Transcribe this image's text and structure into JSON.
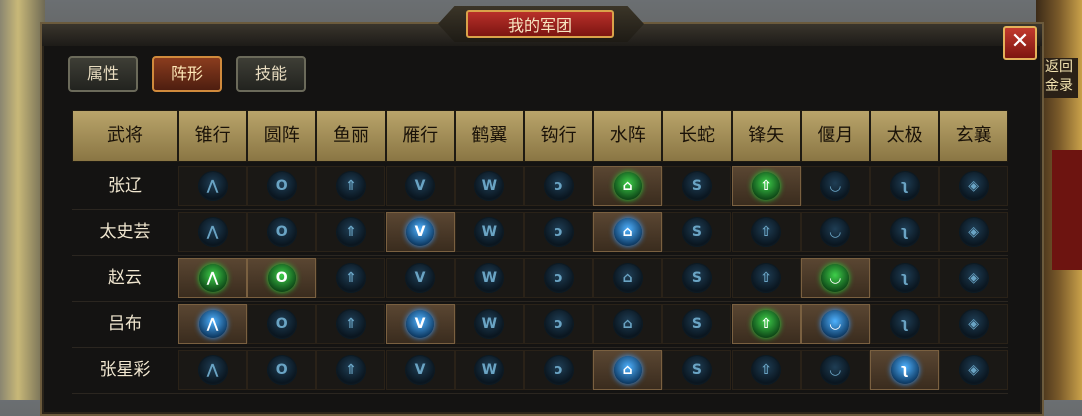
{
  "window": {
    "title": "我的军团",
    "close_symbol": "✕"
  },
  "side": {
    "right_text": "返回\n金录"
  },
  "tabs": [
    {
      "label": "属性",
      "active": false
    },
    {
      "label": "阵形",
      "active": true
    },
    {
      "label": "技能",
      "active": false
    }
  ],
  "table": {
    "name_header": "武将",
    "columns": [
      "锥行",
      "圆阵",
      "鱼丽",
      "雁行",
      "鹤翼",
      "钩行",
      "水阵",
      "长蛇",
      "锋矢",
      "偃月",
      "太极",
      "玄襄"
    ],
    "icon_glyphs": [
      "⋀",
      "O",
      "⇑",
      "V",
      "W",
      "ↄ",
      "⌂",
      "S",
      "⇧",
      "◡",
      "ʅ",
      "◈"
    ],
    "rows": [
      {
        "name": "张辽",
        "states": [
          "d",
          "d",
          "d",
          "d",
          "d",
          "d",
          "g",
          "d",
          "g",
          "d",
          "d",
          "d"
        ]
      },
      {
        "name": "太史芸",
        "states": [
          "d",
          "d",
          "d",
          "b",
          "d",
          "d",
          "b",
          "d",
          "d",
          "d",
          "d",
          "d"
        ]
      },
      {
        "name": "赵云",
        "states": [
          "g",
          "g",
          "d",
          "d",
          "d",
          "d",
          "d",
          "d",
          "d",
          "g",
          "d",
          "d"
        ]
      },
      {
        "name": "吕布",
        "states": [
          "b",
          "d",
          "d",
          "b",
          "d",
          "d",
          "d",
          "d",
          "g",
          "b",
          "d",
          "d"
        ]
      },
      {
        "name": "张星彩",
        "states": [
          "d",
          "d",
          "d",
          "d",
          "d",
          "d",
          "b",
          "d",
          "d",
          "d",
          "b",
          "d"
        ]
      }
    ]
  },
  "colors": {
    "active_blue": "#4fb2ff",
    "active_green": "#3ecf4a",
    "header_gold": "#b9a46a"
  }
}
